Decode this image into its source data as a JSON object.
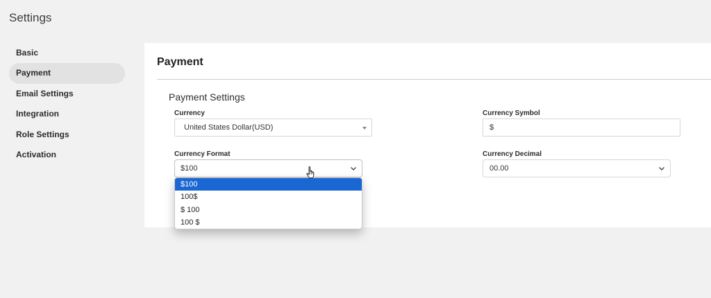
{
  "page": {
    "title": "Settings"
  },
  "sidebar": {
    "items": [
      {
        "label": "Basic"
      },
      {
        "label": "Payment"
      },
      {
        "label": "Email Settings"
      },
      {
        "label": "Integration"
      },
      {
        "label": "Role Settings"
      },
      {
        "label": "Activation"
      }
    ],
    "active": "Payment"
  },
  "panel": {
    "title": "Payment",
    "section_title": "Payment Settings",
    "currency": {
      "label": "Currency",
      "value": "United States Dollar(USD)"
    },
    "currency_symbol": {
      "label": "Currency Symbol",
      "value": "$"
    },
    "currency_format": {
      "label": "Currency Format",
      "value": "$100",
      "options": [
        "$100",
        "100$",
        "$ 100",
        "100 $"
      ],
      "highlighted": "$100"
    },
    "currency_decimal": {
      "label": "Currency Decimal",
      "value": "00.00"
    }
  },
  "colors": {
    "highlight": "#1a66d2",
    "background": "#f1f1f1",
    "active_item": "#e2e2e2"
  }
}
